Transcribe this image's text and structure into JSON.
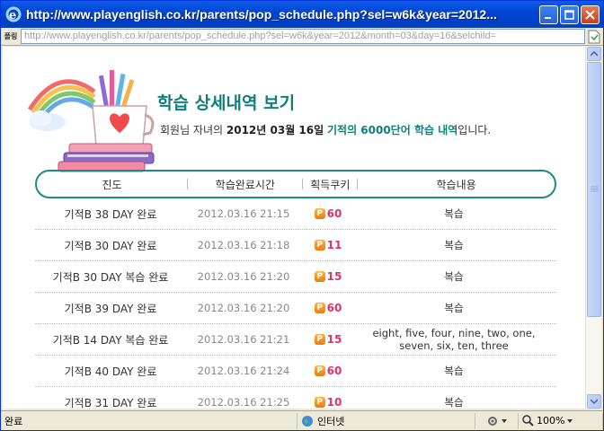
{
  "window": {
    "title": "http://www.playenglish.co.kr/parents/pop_schedule.php?sel=w6k&year=2012...",
    "address": "http://www.playenglish.co.kr/parents/pop_schedule.php?sel=w6k&year=2012&month=03&day=16&selchild=",
    "fav_label": "플링"
  },
  "page": {
    "title": "학습 상세내역 보기",
    "subtitle": {
      "prefix": "회원님 자녀의 ",
      "date": "2012년 03월 16일",
      "space": " ",
      "course": "기적의 6000단어 학습 내역",
      "suffix": "입니다."
    }
  },
  "table": {
    "headers": [
      "진도",
      "학습완료시간",
      "획득쿠키",
      "학습내용"
    ],
    "rows": [
      {
        "progress": "기적B 38 DAY 완료",
        "time": "2012.03.16 21:15",
        "points": "60",
        "content": "복습"
      },
      {
        "progress": "기적B 30 DAY 완료",
        "time": "2012.03.16 21:18",
        "points": "11",
        "content": "복습"
      },
      {
        "progress": "기적B 30 DAY 복습 완료",
        "time": "2012.03.16 21:20",
        "points": "15",
        "content": "복습"
      },
      {
        "progress": "기적B 39 DAY 완료",
        "time": "2012.03.16 21:20",
        "points": "60",
        "content": "복습"
      },
      {
        "progress": "기적B 14 DAY 복습 완료",
        "time": "2012.03.16 21:21",
        "points": "15",
        "content": "eight, five, four, nine, two, one, seven, six, ten, three"
      },
      {
        "progress": "기적B 40 DAY 완료",
        "time": "2012.03.16 21:24",
        "points": "60",
        "content": "복습"
      },
      {
        "progress": "기적B 31 DAY 완료",
        "time": "2012.03.16 21:25",
        "points": "10",
        "content": "복습"
      }
    ],
    "point_icon": "P"
  },
  "statusbar": {
    "status": "완료",
    "zone": "인터넷",
    "zoom": "100%"
  },
  "colors": {
    "accent": "#0e7f7c",
    "points": "#e0336e",
    "titlebar": "#0046d5"
  }
}
